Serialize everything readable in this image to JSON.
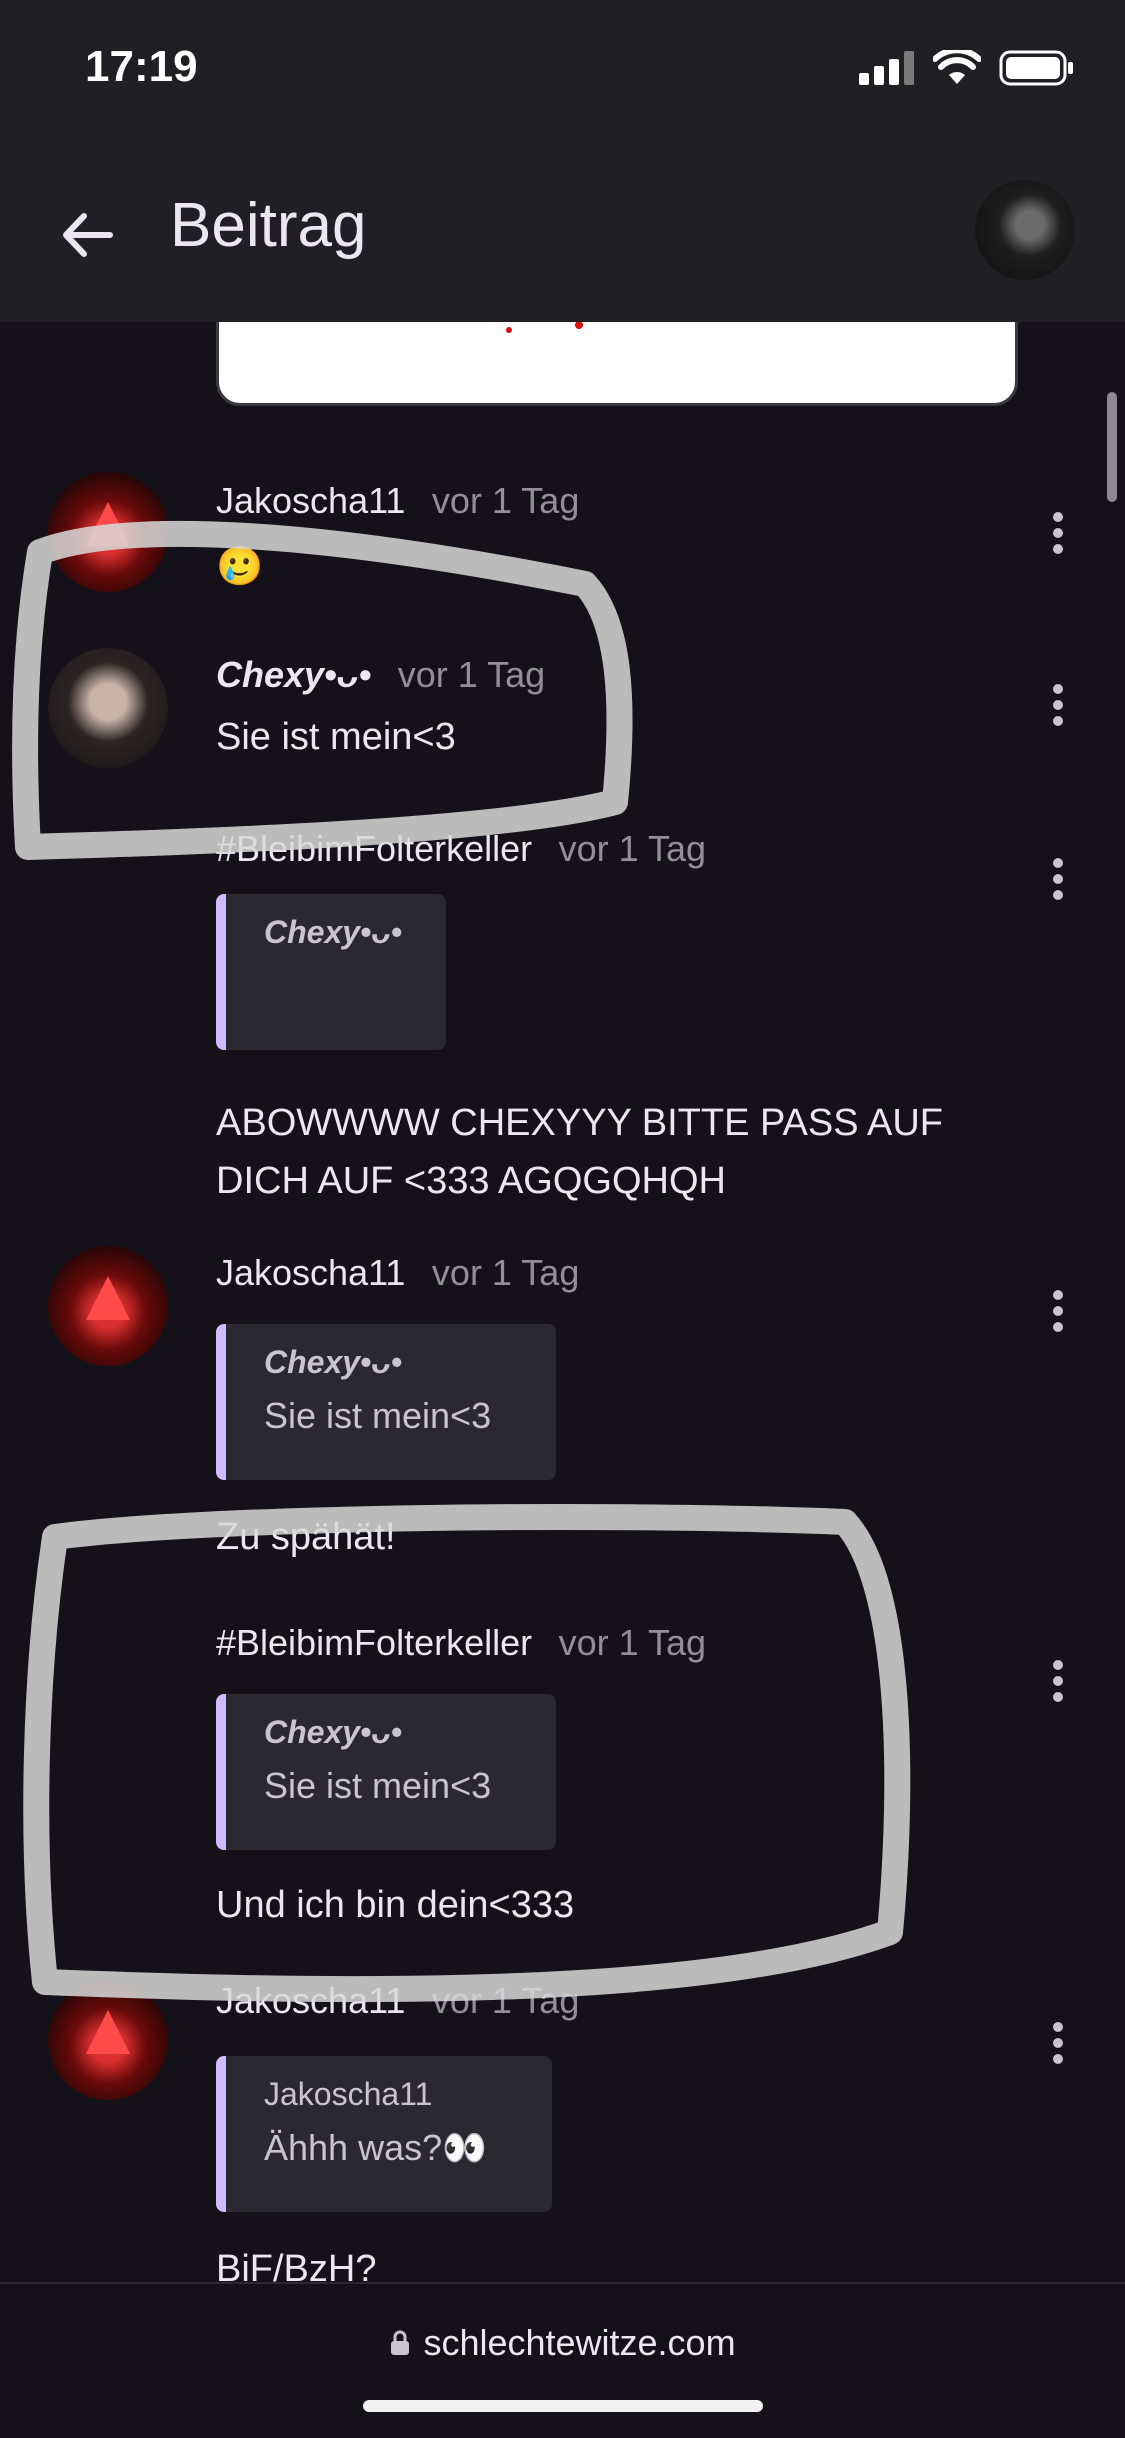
{
  "status": {
    "time": "17:19"
  },
  "appbar": {
    "title": "Beitrag"
  },
  "comments": [
    {
      "author": "Jakoscha11",
      "time": "vor 1 Tag",
      "text": "🥲"
    },
    {
      "author": "Chexy•ᴗ•",
      "time": "vor 1 Tag",
      "text": "Sie ist mein<3"
    },
    {
      "author": "#BleibimFolterkeller",
      "time": "vor 1 Tag",
      "quote_author": "Chexy•ᴗ•",
      "quote_text": "",
      "text": "ABOWWWW CHEXYYY BITTE PASS AUF DICH AUF <333 AGQGQHQH"
    },
    {
      "author": "Jakoscha11",
      "time": "vor 1 Tag",
      "quote_author": "Chexy•ᴗ•",
      "quote_text": "Sie ist mein<3",
      "text": "Zu spähät!"
    },
    {
      "author": "#BleibimFolterkeller",
      "time": "vor 1 Tag",
      "quote_author": "Chexy•ᴗ•",
      "quote_text": "Sie ist mein<3",
      "text": "Und ich bin dein<333"
    },
    {
      "author": "Jakoscha11",
      "time": "vor 1 Tag",
      "quote_author": "Jakoscha11",
      "quote_text": "Ähhh was?👀",
      "text": "BiF/BzH?"
    }
  ],
  "footer": {
    "url": "schlechtewitze.com"
  },
  "colors": {
    "accent": "#CFBCFF",
    "background": "#141218",
    "bar": "#201F24"
  }
}
